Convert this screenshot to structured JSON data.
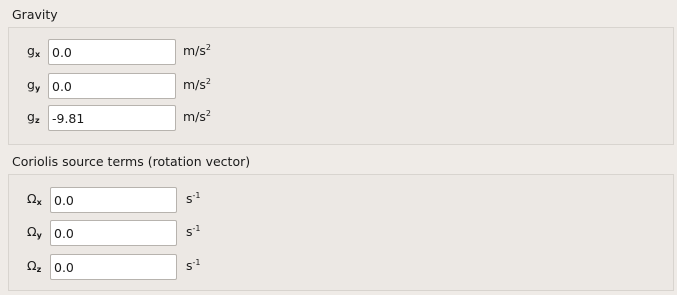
{
  "gravity": {
    "title": "Gravity",
    "rows": [
      {
        "symbol": "g",
        "axis": "x",
        "value": "0.0",
        "unit": "m/s",
        "exp": "2"
      },
      {
        "symbol": "g",
        "axis": "y",
        "value": "0.0",
        "unit": "m/s",
        "exp": "2"
      },
      {
        "symbol": "g",
        "axis": "z",
        "value": "-9.81",
        "unit": "m/s",
        "exp": "2"
      }
    ]
  },
  "coriolis": {
    "title": "Coriolis source terms (rotation vector)",
    "rows": [
      {
        "symbol": "Ω",
        "axis": "x",
        "value": "0.0",
        "unit": "s",
        "exp": "-1"
      },
      {
        "symbol": "Ω",
        "axis": "y",
        "value": "0.0",
        "unit": "s",
        "exp": "-1"
      },
      {
        "symbol": "Ω",
        "axis": "z",
        "value": "0.0",
        "unit": "s",
        "exp": "-1"
      }
    ]
  }
}
